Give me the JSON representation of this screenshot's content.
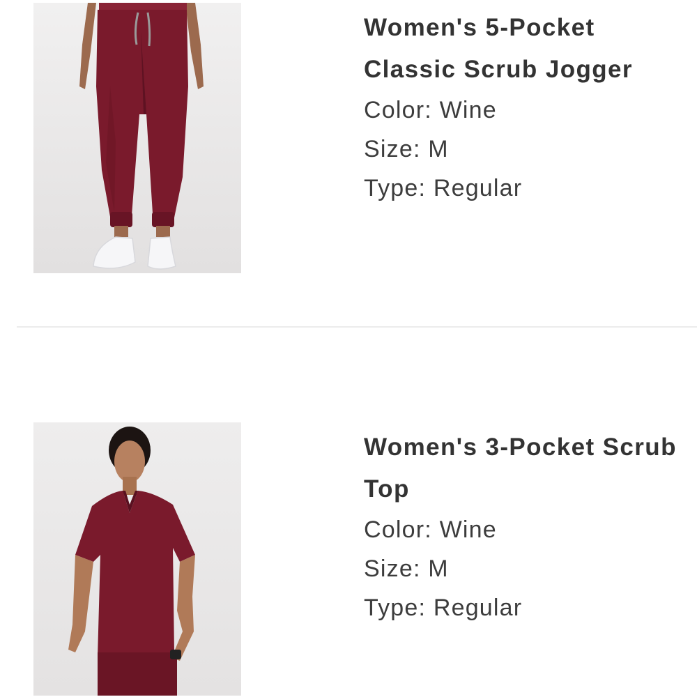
{
  "items": [
    {
      "title": "Women's 5-Pocket Classic Scrub Jogger",
      "attributes": [
        {
          "label": "Color:",
          "value": "Wine"
        },
        {
          "label": "Size:",
          "value": "M"
        },
        {
          "label": "Type:",
          "value": "Regular"
        }
      ],
      "image_subject": "wine scrub jogger pants on model"
    },
    {
      "title": "Women's 3-Pocket Scrub Top",
      "attributes": [
        {
          "label": "Color:",
          "value": "Wine"
        },
        {
          "label": "Size:",
          "value": "M"
        },
        {
          "label": "Type:",
          "value": "Regular"
        }
      ],
      "image_subject": "wine scrub top on model"
    }
  ],
  "colors": {
    "wine": "#7a1a2c",
    "photo_bg": "#eceaea",
    "divider": "#ececec",
    "text": "#3a3a3a"
  }
}
